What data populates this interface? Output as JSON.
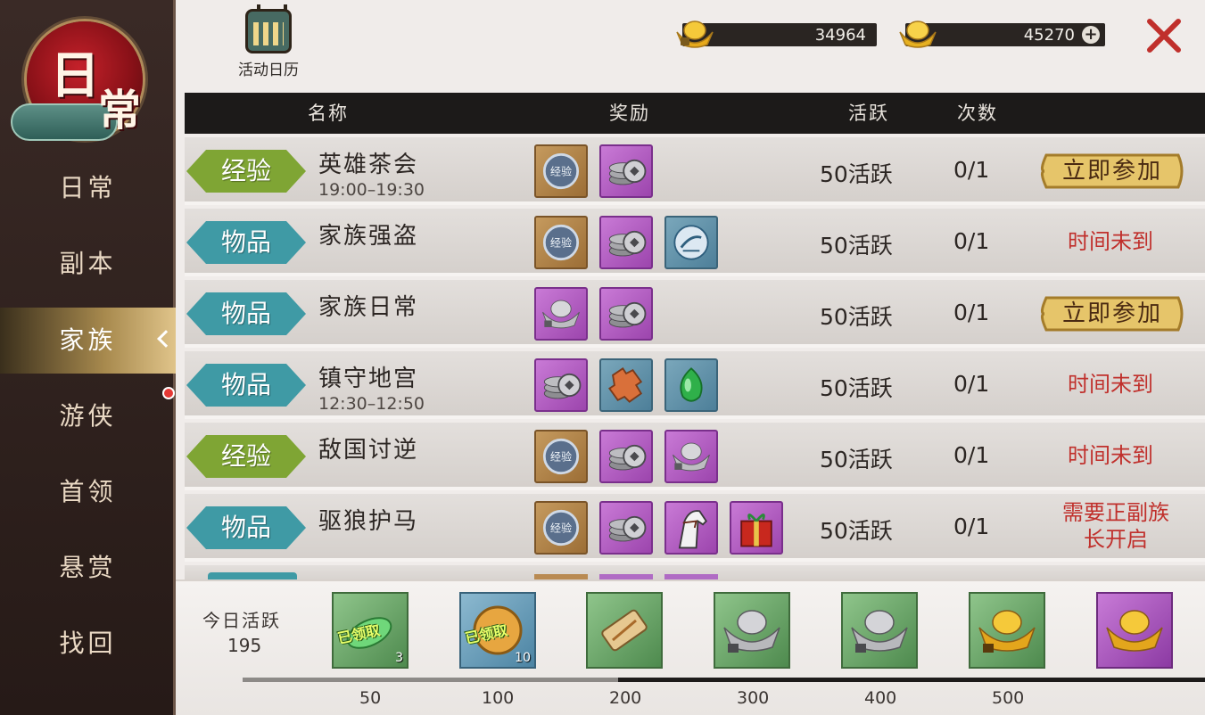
{
  "emblem": {
    "char1": "日",
    "char2": "常"
  },
  "sidebar": {
    "items": [
      {
        "label": "日常"
      },
      {
        "label": "副本"
      },
      {
        "label": "家族",
        "active": true
      },
      {
        "label": "游侠"
      },
      {
        "label": "首领"
      },
      {
        "label": "悬赏"
      },
      {
        "label": "找回"
      }
    ]
  },
  "topbar": {
    "calendar_label": "活动日历",
    "currency1": "34964",
    "currency2": "45270"
  },
  "table": {
    "headers": {
      "name": "名称",
      "reward": "奖励",
      "active": "活跃",
      "count": "次数"
    },
    "rows": [
      {
        "tag": "经验",
        "tag_type": "exp",
        "name": "英雄茶会",
        "time": "19:00–19:30",
        "rewards": [
          "exp",
          "coin"
        ],
        "active": "50活跃",
        "count": "0/1",
        "action": "立即参加"
      },
      {
        "tag": "物品",
        "tag_type": "item",
        "name": "家族强盗",
        "time": "",
        "rewards": [
          "exp",
          "coin",
          "blue-token"
        ],
        "active": "50活跃",
        "count": "0/1",
        "status": "时间未到"
      },
      {
        "tag": "物品",
        "tag_type": "item",
        "name": "家族日常",
        "time": "",
        "rewards": [
          "ingot",
          "coin"
        ],
        "active": "50活跃",
        "count": "0/1",
        "action": "立即参加"
      },
      {
        "tag": "物品",
        "tag_type": "item",
        "name": "镇守地宫",
        "time": "12:30–12:50",
        "rewards": [
          "coin",
          "puzzle",
          "jade"
        ],
        "active": "50活跃",
        "count": "0/1",
        "status": "时间未到"
      },
      {
        "tag": "经验",
        "tag_type": "exp",
        "name": "敌国讨逆",
        "time": "",
        "rewards": [
          "exp",
          "coin",
          "ingot"
        ],
        "active": "50活跃",
        "count": "0/1",
        "status": "时间未到"
      },
      {
        "tag": "物品",
        "tag_type": "item",
        "name": "驱狼护马",
        "time": "",
        "rewards": [
          "exp",
          "coin",
          "horse",
          "giftbox"
        ],
        "active": "50活跃",
        "count": "0/1",
        "status": "需要正副族长开启"
      }
    ]
  },
  "bottom": {
    "today_label": "今日活跃",
    "today_value": "195",
    "progress": 0.39,
    "chests": [
      {
        "claimed_label": "已领取",
        "count": "3"
      },
      {
        "claimed_label": "已领取",
        "count": "10"
      },
      {
        "count": ""
      },
      {
        "count": ""
      },
      {
        "count": ""
      },
      {
        "count": ""
      },
      {
        "count": ""
      }
    ],
    "milestones": [
      "50",
      "100",
      "200",
      "300",
      "400",
      "500"
    ]
  },
  "colors": {
    "exp_tag": "#7fa534",
    "item_tag": "#3f9aa5",
    "status_red": "#c0302c",
    "gold_button": "#e3c46a"
  }
}
